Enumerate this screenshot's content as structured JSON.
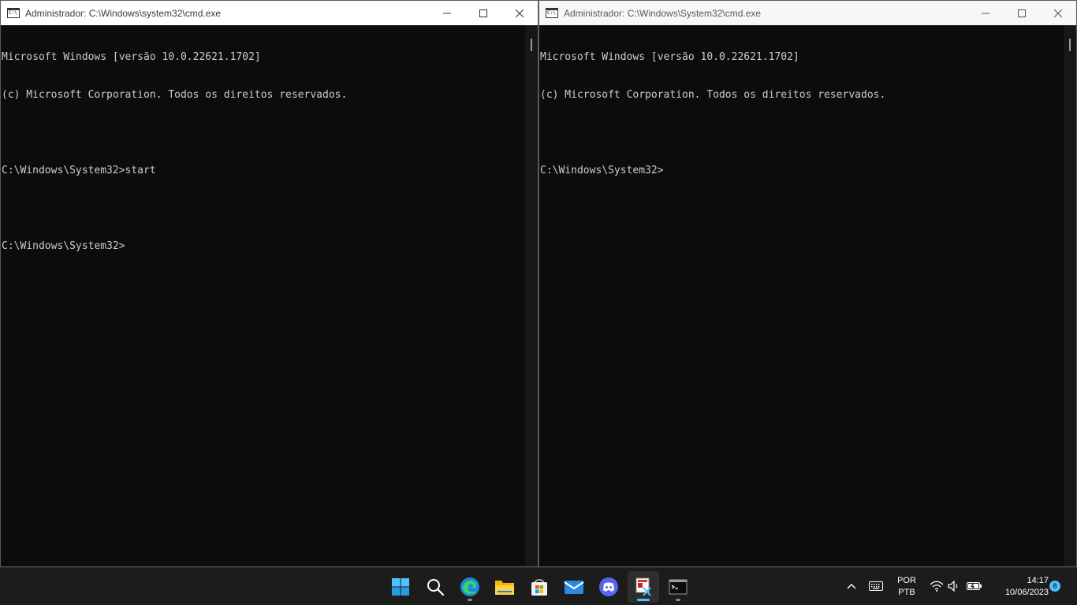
{
  "windows": [
    {
      "title": "Administrador: C:\\Windows\\system32\\cmd.exe",
      "lines": [
        "Microsoft Windows [versão 10.0.22621.1702]",
        "(c) Microsoft Corporation. Todos os direitos reservados.",
        "",
        "C:\\Windows\\System32>start",
        "",
        "C:\\Windows\\System32>"
      ]
    },
    {
      "title": "Administrador: C:\\Windows\\System32\\cmd.exe",
      "lines": [
        "Microsoft Windows [versão 10.0.22621.1702]",
        "(c) Microsoft Corporation. Todos os direitos reservados.",
        "",
        "C:\\Windows\\System32>"
      ]
    }
  ],
  "taskbar": {
    "apps": [
      {
        "name": "start-button",
        "icon": "windows-logo-icon"
      },
      {
        "name": "search-button",
        "icon": "search-icon"
      },
      {
        "name": "edge-button",
        "icon": "edge-icon"
      },
      {
        "name": "file-explorer-button",
        "icon": "folder-icon"
      },
      {
        "name": "store-button",
        "icon": "store-icon"
      },
      {
        "name": "mail-button",
        "icon": "mail-icon"
      },
      {
        "name": "discord-button",
        "icon": "discord-icon"
      },
      {
        "name": "snipping-tool-button",
        "icon": "snipping-tool-icon"
      },
      {
        "name": "terminal-button",
        "icon": "terminal-icon"
      }
    ],
    "language": {
      "line1": "POR",
      "line2": "PTB"
    },
    "clock": {
      "time": "14:17",
      "date": "10/06/2023"
    },
    "notification_count": "8"
  },
  "colors": {
    "console_bg": "#0c0c0c",
    "console_text": "#cccccc",
    "accent": "#4cc2ff",
    "taskbar_bg": "#1c1c1c"
  }
}
